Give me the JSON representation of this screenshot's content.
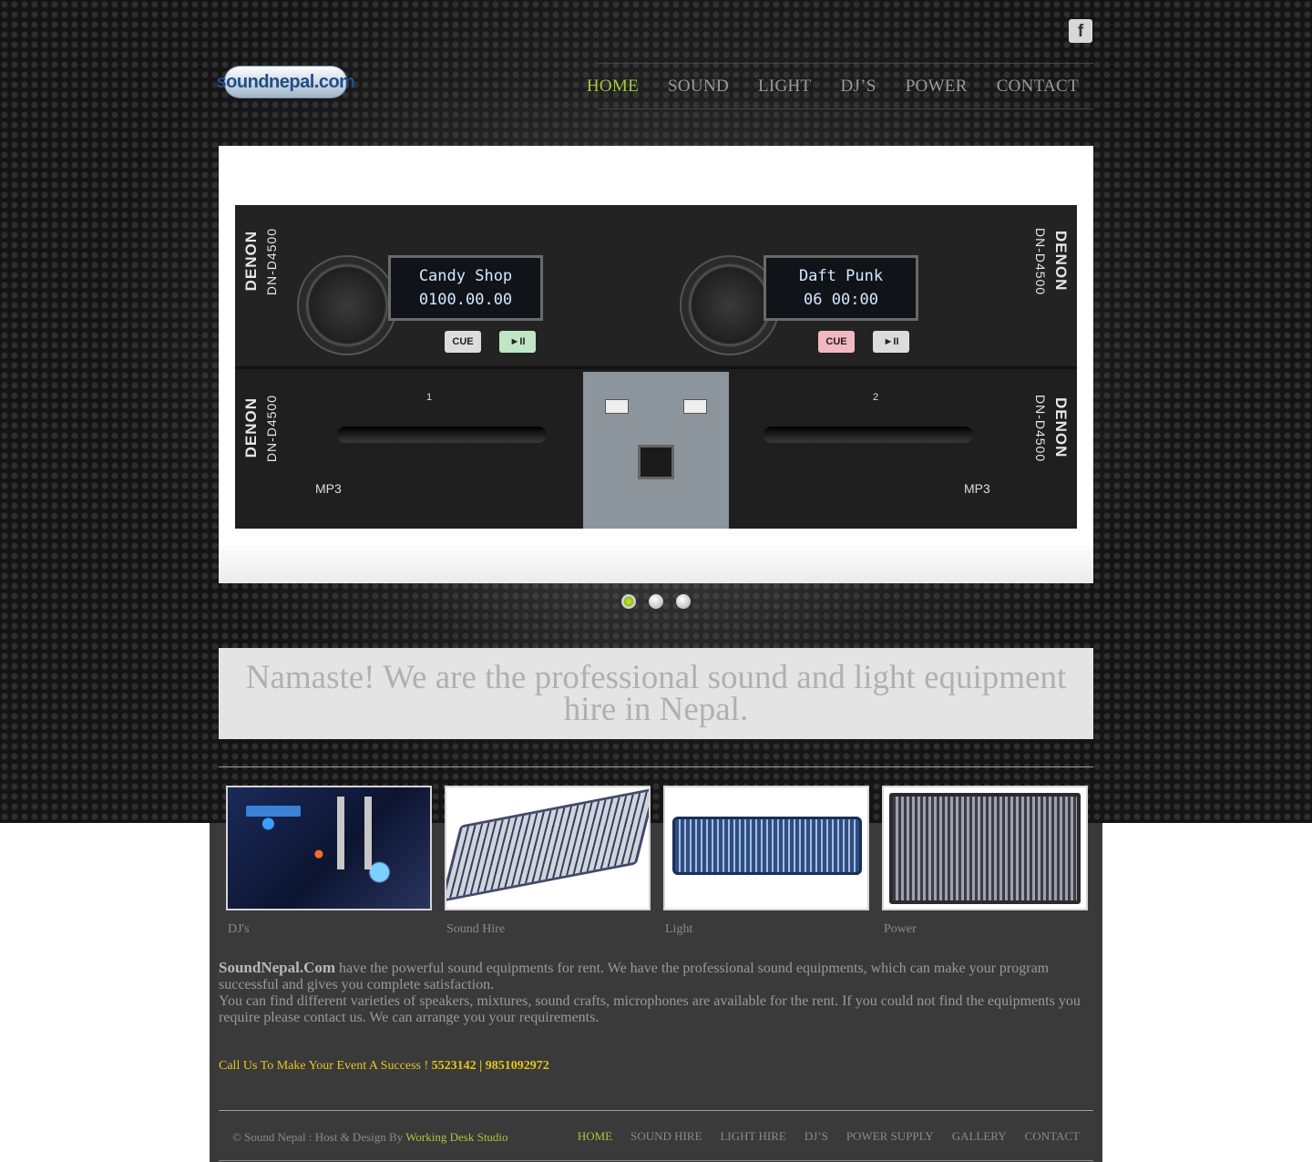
{
  "header": {
    "social": {
      "icon": "facebook-icon",
      "glyph": "f"
    },
    "logo_text": "soundnepal.com",
    "nav": [
      {
        "label": "HOME",
        "active": true
      },
      {
        "label": "SOUND",
        "active": false
      },
      {
        "label": "LIGHT",
        "active": false
      },
      {
        "label": "DJ’S",
        "active": false
      },
      {
        "label": "POWER",
        "active": false
      },
      {
        "label": "CONTACT",
        "active": false
      }
    ]
  },
  "slider": {
    "slide": {
      "brand": "DENON",
      "model": "DN-D4500",
      "deck_left": {
        "track": "Candy Shop",
        "time": "0100.00.00",
        "cue": "CUE",
        "play": "►II",
        "format": "MP3",
        "slot_number": "1"
      },
      "deck_right": {
        "track": "Daft Punk",
        "time": "06 00:00",
        "cue": "CUE",
        "play": "►II",
        "format": "MP3",
        "slot_number": "2"
      }
    },
    "slide_count": 3,
    "active_slide": 1
  },
  "banner": {
    "text": "Namaste! We are the professional sound and light equipment hire in Nepal."
  },
  "categories": [
    {
      "label": "DJ's"
    },
    {
      "label": "Sound Hire"
    },
    {
      "label": "Light"
    },
    {
      "label": "Power"
    }
  ],
  "intro": {
    "brand": "SoundNepal.Com",
    "line1": " have the powerful sound equipments for rent. We have the professional sound equipments, which can make your program successful and gives you complete satisfaction.",
    "line2": "You can find different varieties of speakers, mixtures, sound crafts, microphones are available for the rent. If you could not find the equipments you require please contact us. We can arrange you your requirements."
  },
  "call": {
    "text": "Call Us To Make Your Event A Success ! ",
    "phones": " 5523142 | 9851092972"
  },
  "footer": {
    "copyright": "© Sound Nepal : Host & Design By ",
    "designer": "Working Desk Studio",
    "nav": [
      {
        "label": "HOME",
        "active": true
      },
      {
        "label": "SOUND HIRE",
        "active": false
      },
      {
        "label": "LIGHT HIRE",
        "active": false
      },
      {
        "label": "DJ’S",
        "active": false
      },
      {
        "label": "POWER SUPPLY",
        "active": false
      },
      {
        "label": "GALLERY",
        "active": false
      },
      {
        "label": "CONTACT",
        "active": false
      }
    ]
  },
  "colors": {
    "accent": "#a6c83a",
    "phone_highlight": "#e8c51e",
    "nav_text": "#9a9a9a",
    "page_bg_lower": "#3a3a3a"
  }
}
